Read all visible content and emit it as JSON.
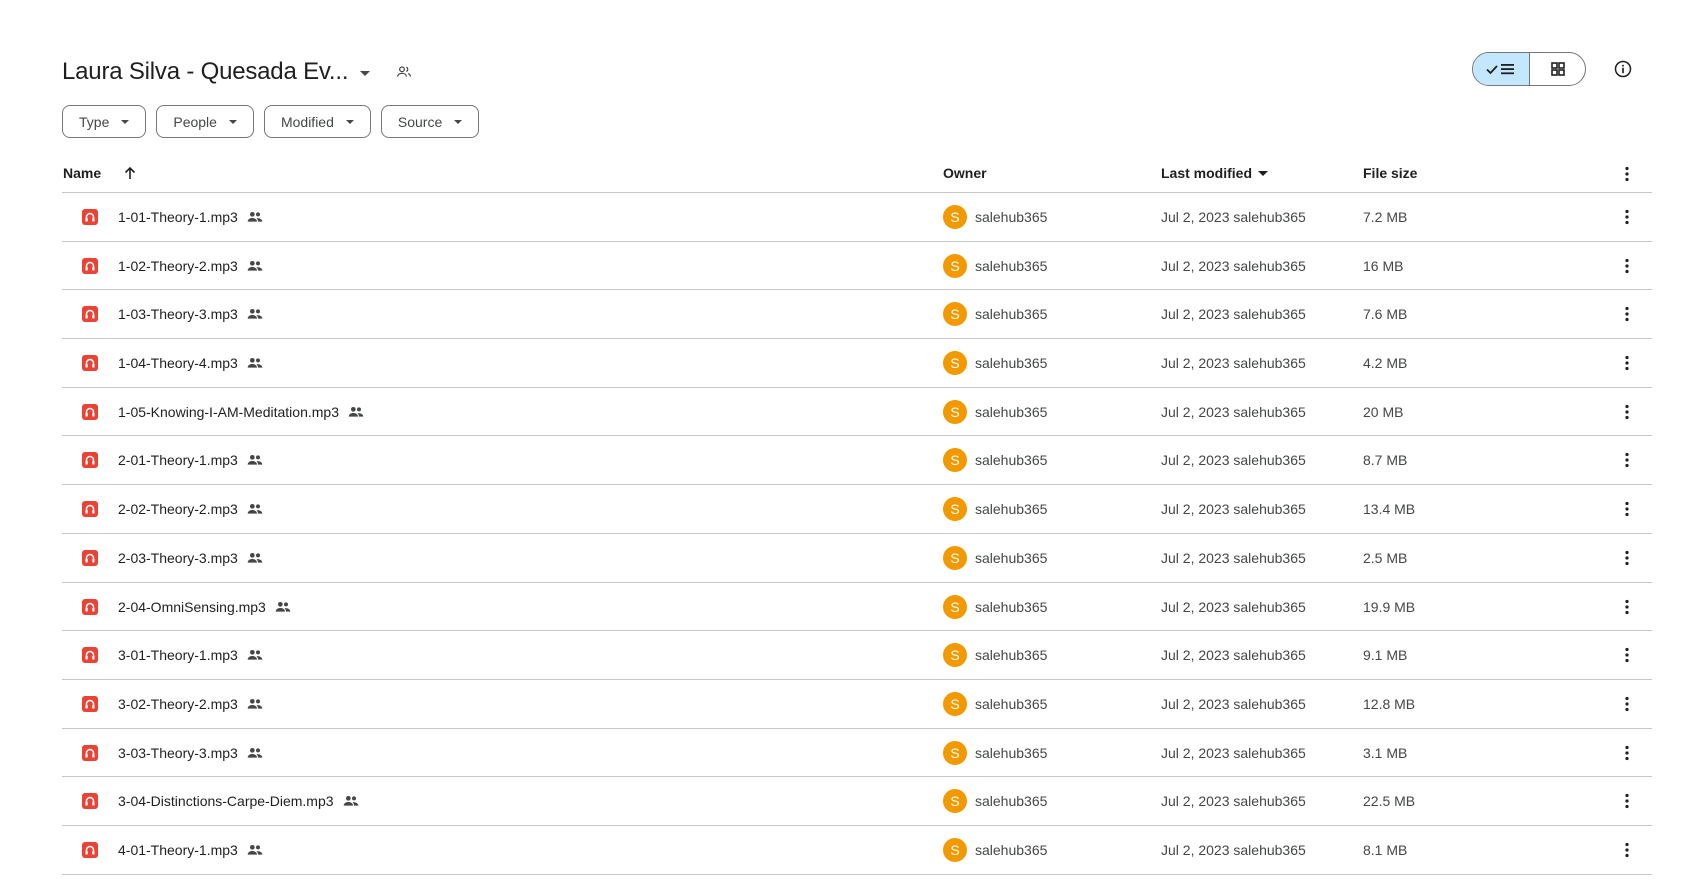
{
  "header": {
    "title": "Laura Silva - Quesada Ev...",
    "title_dropdown_icon": "caret-down-icon",
    "shared_icon": "shared-folder-icon",
    "view_list_icon": "check-list-icon",
    "view_grid_icon": "grid-icon",
    "info_icon": "info-icon"
  },
  "filters": [
    {
      "label": "Type"
    },
    {
      "label": "People"
    },
    {
      "label": "Modified"
    },
    {
      "label": "Source"
    }
  ],
  "columns": {
    "name": "Name",
    "owner": "Owner",
    "last_modified": "Last modified",
    "file_size": "File size"
  },
  "rows": [
    {
      "name": "1-01-Theory-1.mp3",
      "owner": "salehub365",
      "owner_initial": "S",
      "modified": "Jul 2, 2023 salehub365",
      "size": "7.2 MB"
    },
    {
      "name": "1-02-Theory-2.mp3",
      "owner": "salehub365",
      "owner_initial": "S",
      "modified": "Jul 2, 2023 salehub365",
      "size": "16 MB"
    },
    {
      "name": "1-03-Theory-3.mp3",
      "owner": "salehub365",
      "owner_initial": "S",
      "modified": "Jul 2, 2023 salehub365",
      "size": "7.6 MB"
    },
    {
      "name": "1-04-Theory-4.mp3",
      "owner": "salehub365",
      "owner_initial": "S",
      "modified": "Jul 2, 2023 salehub365",
      "size": "4.2 MB"
    },
    {
      "name": "1-05-Knowing-I-AM-Meditation.mp3",
      "owner": "salehub365",
      "owner_initial": "S",
      "modified": "Jul 2, 2023 salehub365",
      "size": "20 MB"
    },
    {
      "name": "2-01-Theory-1.mp3",
      "owner": "salehub365",
      "owner_initial": "S",
      "modified": "Jul 2, 2023 salehub365",
      "size": "8.7 MB"
    },
    {
      "name": "2-02-Theory-2.mp3",
      "owner": "salehub365",
      "owner_initial": "S",
      "modified": "Jul 2, 2023 salehub365",
      "size": "13.4 MB"
    },
    {
      "name": "2-03-Theory-3.mp3",
      "owner": "salehub365",
      "owner_initial": "S",
      "modified": "Jul 2, 2023 salehub365",
      "size": "2.5 MB"
    },
    {
      "name": "2-04-OmniSensing.mp3",
      "owner": "salehub365",
      "owner_initial": "S",
      "modified": "Jul 2, 2023 salehub365",
      "size": "19.9 MB"
    },
    {
      "name": "3-01-Theory-1.mp3",
      "owner": "salehub365",
      "owner_initial": "S",
      "modified": "Jul 2, 2023 salehub365",
      "size": "9.1 MB"
    },
    {
      "name": "3-02-Theory-2.mp3",
      "owner": "salehub365",
      "owner_initial": "S",
      "modified": "Jul 2, 2023 salehub365",
      "size": "12.8 MB"
    },
    {
      "name": "3-03-Theory-3.mp3",
      "owner": "salehub365",
      "owner_initial": "S",
      "modified": "Jul 2, 2023 salehub365",
      "size": "3.1 MB"
    },
    {
      "name": "3-04-Distinctions-Carpe-Diem.mp3",
      "owner": "salehub365",
      "owner_initial": "S",
      "modified": "Jul 2, 2023 salehub365",
      "size": "22.5 MB"
    },
    {
      "name": "4-01-Theory-1.mp3",
      "owner": "salehub365",
      "owner_initial": "S",
      "modified": "Jul 2, 2023 salehub365",
      "size": "8.1 MB"
    }
  ],
  "colors": {
    "file_icon": "#ea4335",
    "avatar": "#f29900",
    "toggle_active": "#c2e7ff",
    "divider": "#c7c7c7"
  }
}
